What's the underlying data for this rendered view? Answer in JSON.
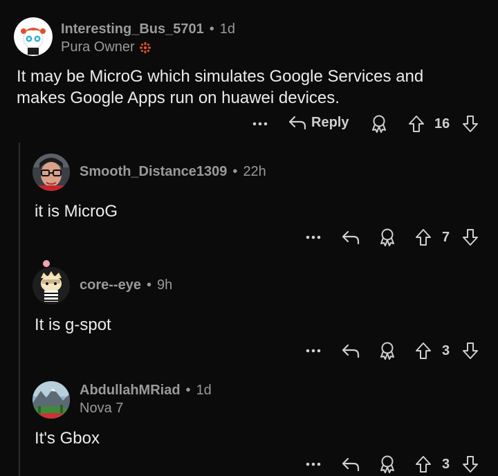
{
  "comments": [
    {
      "username": "Interesting_Bus_5701",
      "age": "1d",
      "flair": "Pura Owner",
      "body_lines": [
        "It may be MicroG which simulates Google Services and",
        "makes Google Apps run on huawei devices."
      ],
      "reply_label": "Reply",
      "votes": "16",
      "avatar_icon": "snoo-avatar"
    },
    {
      "username": "Smooth_Distance1309",
      "age": "22h",
      "body": "it is MicroG",
      "votes": "7",
      "avatar_icon": "person-glasses-avatar"
    },
    {
      "username": "core--eye",
      "age": "9h",
      "body": "It is g-spot",
      "votes": "3",
      "avatar_icon": "cartoon-avatar"
    },
    {
      "username": "AbdullahMRiad",
      "age": "1d",
      "flair": "Nova 7",
      "body": "It's Gbox",
      "votes": "3",
      "avatar_icon": "landscape-avatar"
    }
  ],
  "separator": "•",
  "colors": {
    "background": "#0b0b0b",
    "text": "#ececec",
    "meta": "#9a9a9a",
    "flair_icon": "#e0522a"
  }
}
